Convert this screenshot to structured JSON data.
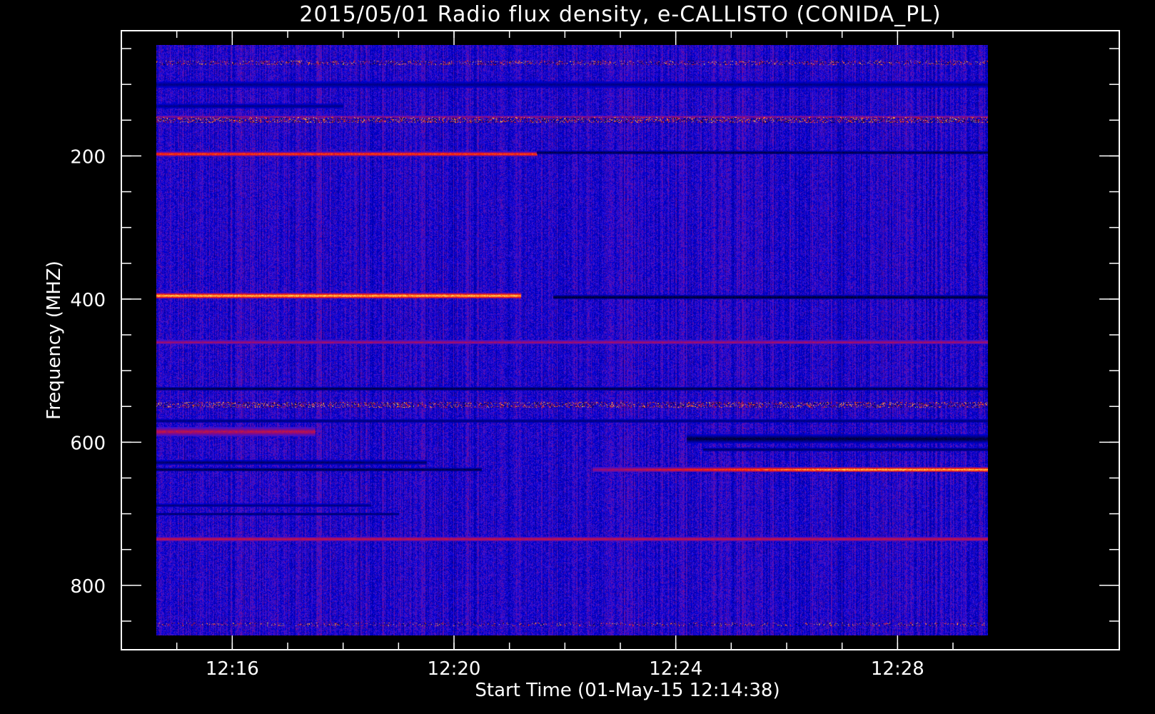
{
  "chart_data": {
    "type": "heatmap",
    "title": "2015/05/01  Radio flux density, e-CALLISTO (CONIDA_PL)",
    "xlabel": "Start Time (01-May-15 12:14:38)",
    "ylabel": "Frequency (MHZ)",
    "x_unit": "minutes of day (12:00 = 720)",
    "xlim": [
      734.0,
      752.0
    ],
    "x_data_range": [
      734.633,
      749.633
    ],
    "x_ticks": [
      {
        "value": 736,
        "label": "12:16"
      },
      {
        "value": 740,
        "label": "12:20"
      },
      {
        "value": 744,
        "label": "12:24"
      },
      {
        "value": 748,
        "label": "12:28"
      }
    ],
    "x_minor_step": 1,
    "ylim": [
      890,
      25
    ],
    "y_data_range": [
      45,
      870
    ],
    "y_ticks": [
      {
        "value": 200,
        "label": "200"
      },
      {
        "value": 400,
        "label": "400"
      },
      {
        "value": 600,
        "label": "600"
      },
      {
        "value": 800,
        "label": "800"
      }
    ],
    "y_minor_step": 50,
    "background_color": "#1a1ad6",
    "colors": {
      "bg": "#000000",
      "frame": "#ffffff",
      "low": "#000000",
      "mid": "#1010e0",
      "high": "#ff2000",
      "peak": "#ffe060"
    },
    "features": [
      {
        "name": "band-195",
        "freq": 197,
        "kind": "bright",
        "t_start": 734.633,
        "t_end": 741.5,
        "intensity": 0.7,
        "width": 6
      },
      {
        "name": "band-195-dark",
        "freq": 195,
        "kind": "dark",
        "t_start": 741.5,
        "t_end": 749.633,
        "intensity": 0.9,
        "width": 5
      },
      {
        "name": "band-395",
        "freq": 395,
        "kind": "bright",
        "t_start": 734.633,
        "t_end": 741.2,
        "intensity": 1.0,
        "width": 8
      },
      {
        "name": "band-395-dark",
        "freq": 397,
        "kind": "dark",
        "t_start": 741.8,
        "t_end": 749.633,
        "intensity": 1.0,
        "width": 6
      },
      {
        "name": "band-460",
        "freq": 460,
        "kind": "bright",
        "t_start": 734.633,
        "t_end": 749.633,
        "intensity": 0.35,
        "width": 5
      },
      {
        "name": "band-525-dark",
        "freq": 525,
        "kind": "dark",
        "t_start": 734.633,
        "t_end": 749.633,
        "intensity": 0.9,
        "width": 5
      },
      {
        "name": "band-548",
        "freq": 548,
        "kind": "speckle",
        "t_start": 734.633,
        "t_end": 749.633,
        "intensity": 0.8,
        "width": 7
      },
      {
        "name": "band-570-dark",
        "freq": 570,
        "kind": "dark",
        "t_start": 734.633,
        "t_end": 749.633,
        "intensity": 0.6,
        "width": 5
      },
      {
        "name": "band-585",
        "freq": 585,
        "kind": "bright",
        "t_start": 734.633,
        "t_end": 737.5,
        "intensity": 0.4,
        "width": 12
      },
      {
        "name": "band-595-dark",
        "freq": 595,
        "kind": "dark",
        "t_start": 744.2,
        "t_end": 749.633,
        "intensity": 0.9,
        "width": 12
      },
      {
        "name": "band-610-dark",
        "freq": 610,
        "kind": "dark",
        "t_start": 744.5,
        "t_end": 749.633,
        "intensity": 0.7,
        "width": 5
      },
      {
        "name": "band-628-dark",
        "freq": 628,
        "kind": "dark",
        "t_start": 734.633,
        "t_end": 739.5,
        "intensity": 0.7,
        "width": 6
      },
      {
        "name": "band-638-dark",
        "freq": 638,
        "kind": "dark",
        "t_start": 734.633,
        "t_end": 740.5,
        "intensity": 0.9,
        "width": 5
      },
      {
        "name": "band-638",
        "freq": 638,
        "kind": "bright",
        "t_start": 742.5,
        "t_end": 749.633,
        "intensity": 1.0,
        "width": 7,
        "ramp": true
      },
      {
        "name": "band-690-dark",
        "freq": 688,
        "kind": "dark",
        "t_start": 734.633,
        "t_end": 738.5,
        "intensity": 0.6,
        "width": 4
      },
      {
        "name": "band-700-dark",
        "freq": 700,
        "kind": "dark",
        "t_start": 734.633,
        "t_end": 739.0,
        "intensity": 0.8,
        "width": 3
      },
      {
        "name": "band-735",
        "freq": 735,
        "kind": "bright",
        "t_start": 734.633,
        "t_end": 749.633,
        "intensity": 0.45,
        "width": 6
      },
      {
        "name": "band-855",
        "freq": 855,
        "kind": "speckle",
        "t_start": 734.633,
        "t_end": 749.633,
        "intensity": 0.4,
        "width": 4
      },
      {
        "name": "band-70",
        "freq": 70,
        "kind": "speckle",
        "t_start": 734.633,
        "t_end": 749.633,
        "intensity": 0.6,
        "width": 5
      },
      {
        "name": "band-100-dark",
        "freq": 100,
        "kind": "dark",
        "t_start": 734.633,
        "t_end": 749.633,
        "intensity": 0.5,
        "width": 8
      },
      {
        "name": "band-130-dark",
        "freq": 130,
        "kind": "dark",
        "t_start": 734.633,
        "t_end": 738.0,
        "intensity": 0.5,
        "width": 6
      },
      {
        "name": "band-150",
        "freq": 150,
        "kind": "speckle",
        "t_start": 734.633,
        "t_end": 749.633,
        "intensity": 0.9,
        "width": 7
      },
      {
        "name": "band-145",
        "freq": 145,
        "kind": "bright",
        "t_start": 734.633,
        "t_end": 749.633,
        "intensity": 0.3,
        "width": 3
      }
    ]
  }
}
